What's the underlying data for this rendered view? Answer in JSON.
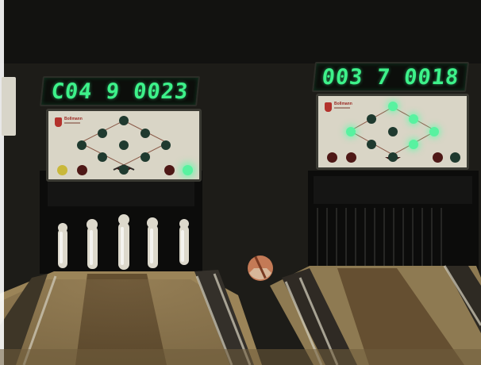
{
  "lane_left": {
    "scoreboard": "C04 9 0023",
    "panel_brand": "Bollmann",
    "display_color": "#3df28a",
    "pins_lit": [
      false,
      false,
      false,
      false,
      false,
      false,
      false,
      false,
      false
    ],
    "aux_lamps_lit": [
      false,
      false,
      false,
      true
    ]
  },
  "lane_right": {
    "scoreboard": "003 7 0018",
    "panel_brand": "Bollmann",
    "display_color": "#3df28a",
    "pins_lit": [
      true,
      false,
      true,
      true,
      false,
      true,
      false,
      true,
      false
    ],
    "aux_lamps_lit": [
      false,
      false,
      false,
      false
    ]
  },
  "side_card_text": "",
  "colors": {
    "lamp_on": "#58f2a0",
    "lamp_off": "#1f3a2f",
    "lamp_red": "#4e1816",
    "lamp_yellow": "#c9b83a",
    "panel": "#d9d5c6"
  }
}
